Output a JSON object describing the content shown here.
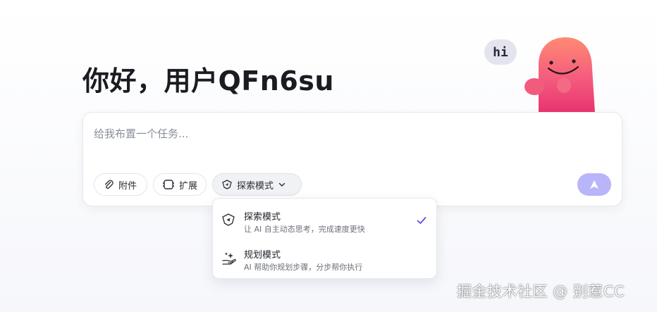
{
  "greeting": "你好，用户QFn6su",
  "mascot": {
    "bubble_text": "hi"
  },
  "composer": {
    "placeholder": "给我布置一个任务...",
    "buttons": {
      "attach_label": "附件",
      "expand_label": "扩展",
      "mode_label": "探索模式"
    },
    "send_icon": "send-arrow-icon"
  },
  "mode_menu": {
    "options": [
      {
        "title": "探索模式",
        "desc": "让 AI 自主动态思考，完成速度更快",
        "selected": true,
        "icon": "compass-tag-icon"
      },
      {
        "title": "规划模式",
        "desc": "AI 帮助你规划步骤，分步帮你执行",
        "selected": false,
        "icon": "sparkle-hand-icon"
      }
    ]
  },
  "watermark": "掘金技术社区 @ 别惹CC",
  "colors": {
    "accent": "#5b4ee8",
    "send_button": "#b8b5fa",
    "mascot": "#f0507a"
  }
}
